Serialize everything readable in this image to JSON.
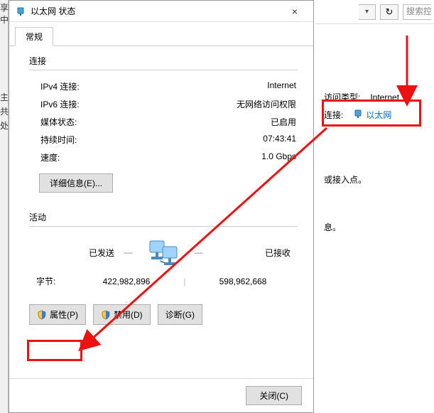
{
  "titlebar": {
    "title": "以太网 状态",
    "icon": "ethernet-icon",
    "close": "×"
  },
  "tabs": {
    "general": "常规"
  },
  "connection_section": {
    "label": "连接",
    "ipv4_label": "IPv4 连接:",
    "ipv4_value": "Internet",
    "ipv6_label": "IPv6 连接:",
    "ipv6_value": "无网络访问权限",
    "media_label": "媒体状态:",
    "media_value": "已启用",
    "duration_label": "持续时间:",
    "duration_value": "07:43:41",
    "speed_label": "速度:",
    "speed_value": "1.0 Gbps",
    "details_btn": "详细信息(E)..."
  },
  "activity_section": {
    "label": "活动",
    "sent_label": "已发送",
    "recv_label": "已接收",
    "bytes_label": "字节:",
    "sent_value": "422,982,896",
    "recv_value": "598,962,668"
  },
  "action_buttons": {
    "properties": "属性(P)",
    "disable": "禁用(D)",
    "diagnose": "诊断(G)"
  },
  "dialog_buttons": {
    "close": "关闭(C)"
  },
  "left_fragments": {
    "a": "享中",
    "b": "主",
    "c": "共",
    "d": "处"
  },
  "right_pane": {
    "search_placeholder": "搜索控",
    "access_type_label": "访问类型:",
    "access_type_value": "Internet",
    "conn_label": "连接:",
    "conn_link": "以太网",
    "text1": "或接入点。",
    "text2": "息。"
  }
}
